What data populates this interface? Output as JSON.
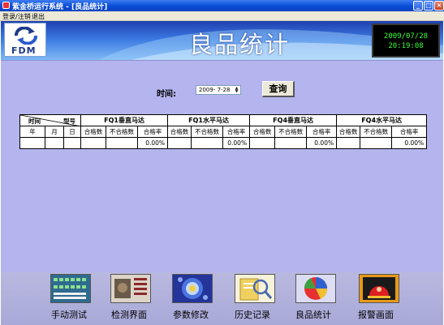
{
  "window": {
    "title": "紫金桥运行系统 - [良品统计]",
    "buttons": {
      "minimize": "_",
      "maximize": "□",
      "close": "×"
    }
  },
  "menu": {
    "items": [
      "登录/注销",
      "退出"
    ]
  },
  "header": {
    "logo_text": "FDM",
    "page_title": "良品统计",
    "clock": {
      "date": "2009/07/28",
      "time": "20:19:08"
    }
  },
  "query": {
    "label": "时间:",
    "date_value": "2009- 7-28",
    "button_label": "查询"
  },
  "table": {
    "corner": {
      "time": "时间",
      "model": "型号"
    },
    "date_cols": [
      "年",
      "月",
      "日"
    ],
    "motors": [
      "FQ1垂直马达",
      "FQ1水平马达",
      "FQ4垂直马达",
      "FQ4水平马达"
    ],
    "subcols": [
      "合格数",
      "不合格数",
      "合格率"
    ],
    "rates": [
      "0.00%",
      "0.00%",
      "0.00%",
      "0.00%"
    ]
  },
  "nav": {
    "items": [
      {
        "label": "手动测试",
        "icon": "manual-test-icon"
      },
      {
        "label": "检测界面",
        "icon": "inspection-icon"
      },
      {
        "label": "参数修改",
        "icon": "parameters-icon"
      },
      {
        "label": "历史记录",
        "icon": "history-icon"
      },
      {
        "label": "良品统计",
        "icon": "statistics-icon"
      },
      {
        "label": "报警画面",
        "icon": "alarm-icon"
      }
    ]
  },
  "colors": {
    "panel_bg": "#b4b4ee",
    "clock_text": "#3cff3c",
    "titlebar": "#0a4fd8"
  }
}
